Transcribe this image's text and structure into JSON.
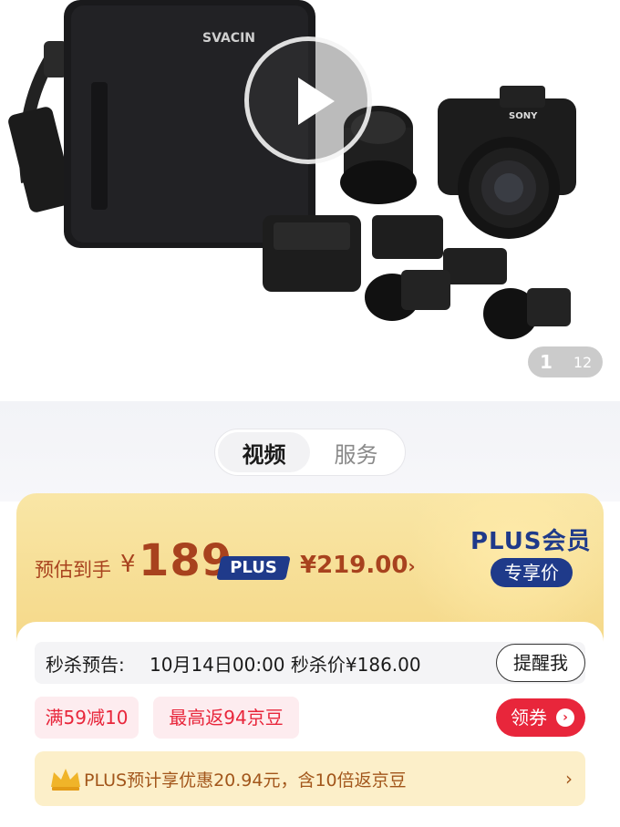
{
  "gallery": {
    "brand_on_bag": "SVACIN",
    "camera_brand": "SONY",
    "current_index": "1",
    "total": "12"
  },
  "tabs": [
    {
      "label": "视频",
      "active": true
    },
    {
      "label": "服务",
      "active": false
    }
  ],
  "price": {
    "estimate_label": "预估到手",
    "currency": "¥",
    "amount": "189",
    "plus_tag": "PLUS",
    "plus_price": "¥219.00",
    "plus_arrow": "›",
    "member_title": "PLUS会员",
    "member_badge": "专享价"
  },
  "flash_sale": {
    "label": "秒杀预告:",
    "detail": "10月14日00:00 秒杀价¥186.00",
    "remind_label": "提醒我"
  },
  "coupons": [
    {
      "text": "满59减10"
    },
    {
      "text": "最高返94京豆"
    }
  ],
  "get_coupon_label": "领券",
  "get_coupon_icon": "›",
  "plus_benefit": {
    "text": "PLUS预计享优惠20.94元，含10倍返京豆",
    "arrow": "›"
  },
  "colors": {
    "accent_red": "#e8263b",
    "price_brown": "#a8421e",
    "plus_navy": "#1f3a8a",
    "gold_bg": "#f5d98a"
  }
}
